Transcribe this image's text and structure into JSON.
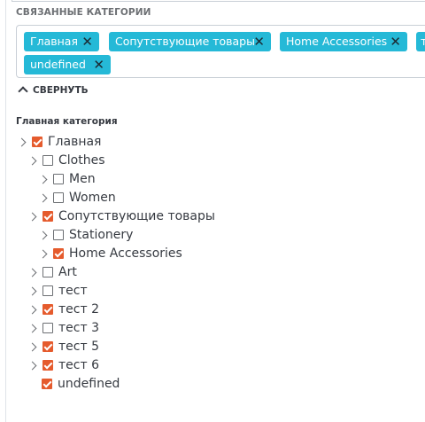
{
  "related_categories": {
    "title": "СВЯЗАННЫЕ КАТЕГОРИИ",
    "tags": [
      {
        "label": "Главная"
      },
      {
        "label": "Сопутствующие товары"
      },
      {
        "label": "Home Accessories"
      },
      {
        "label": "т"
      },
      {
        "label": "undefined"
      }
    ],
    "collapse_label": "СВЕРНУТЬ"
  },
  "main_category": {
    "label": "Главная категория",
    "tree": [
      {
        "label": "Главная",
        "checked": true,
        "expandable": true
      },
      {
        "label": "Clothes",
        "checked": false,
        "expandable": true
      },
      {
        "label": "Men",
        "checked": false,
        "expandable": true
      },
      {
        "label": "Women",
        "checked": false,
        "expandable": true
      },
      {
        "label": "Сопутствующие товары",
        "checked": true,
        "expandable": true
      },
      {
        "label": "Stationery",
        "checked": false,
        "expandable": true
      },
      {
        "label": "Home Accessories",
        "checked": true,
        "expandable": true
      },
      {
        "label": "Art",
        "checked": false,
        "expandable": true
      },
      {
        "label": "тест",
        "checked": false,
        "expandable": true
      },
      {
        "label": "тест 2",
        "checked": true,
        "expandable": true
      },
      {
        "label": "тест 3",
        "checked": false,
        "expandable": true
      },
      {
        "label": "тест 5",
        "checked": true,
        "expandable": true
      },
      {
        "label": "тест 6",
        "checked": true,
        "expandable": true
      },
      {
        "label": "undefined",
        "checked": true,
        "expandable": false
      }
    ]
  },
  "colors": {
    "tag_bg": "#25b9d7",
    "checkbox_checked": "#e55b2d"
  }
}
